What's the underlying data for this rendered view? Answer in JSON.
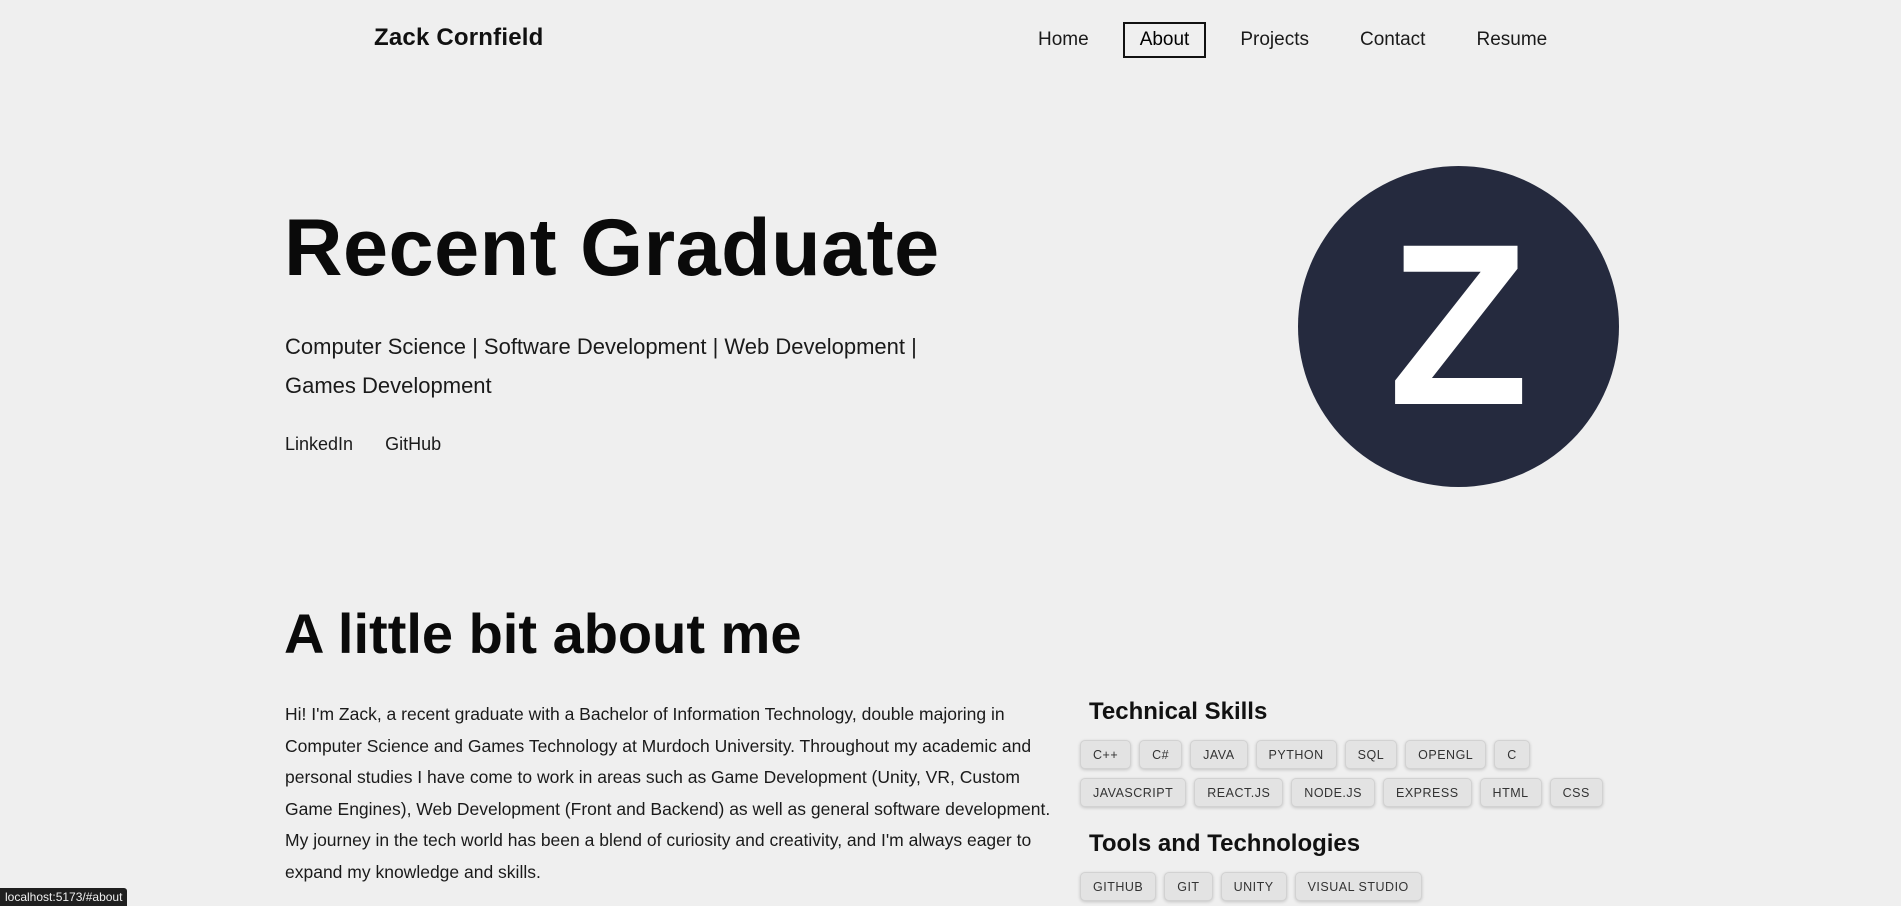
{
  "header": {
    "brand": "Zack Cornfield",
    "nav": [
      {
        "label": "Home",
        "active": false
      },
      {
        "label": "About",
        "active": true
      },
      {
        "label": "Projects",
        "active": false
      },
      {
        "label": "Contact",
        "active": false
      },
      {
        "label": "Resume",
        "active": false
      }
    ]
  },
  "hero": {
    "title": "Recent Graduate",
    "subtitle": "Computer Science | Software Development | Web Development | Games Development",
    "links": [
      "LinkedIn",
      "GitHub"
    ],
    "avatar_letter": "Z",
    "avatar_color": "#252a3e"
  },
  "about": {
    "title": "A little bit about me",
    "text": "Hi! I'm Zack, a recent graduate with a Bachelor of Information Technology, double majoring in Computer Science and Games Technology at Murdoch University. Throughout my academic and personal studies I have come to work in areas such as Game Development (Unity, VR, Custom Game Engines), Web Development (Front and Backend) as well as general software development. My journey in the tech world has been a blend of curiosity and creativity, and I'm always eager to expand my knowledge and skills."
  },
  "skills": {
    "technical_title": "Technical Skills",
    "technical_row1": [
      "C++",
      "C#",
      "JAVA",
      "PYTHON",
      "SQL",
      "OPENGL",
      "C"
    ],
    "technical_row2": [
      "JAVASCRIPT",
      "REACT.JS",
      "NODE.JS",
      "EXPRESS",
      "HTML",
      "CSS"
    ],
    "tools_title": "Tools and Technologies",
    "tools_row1": [
      "GITHUB",
      "GIT",
      "UNITY",
      "VISUAL STUDIO"
    ]
  },
  "status_bar": {
    "url": "localhost:5173/#about"
  }
}
